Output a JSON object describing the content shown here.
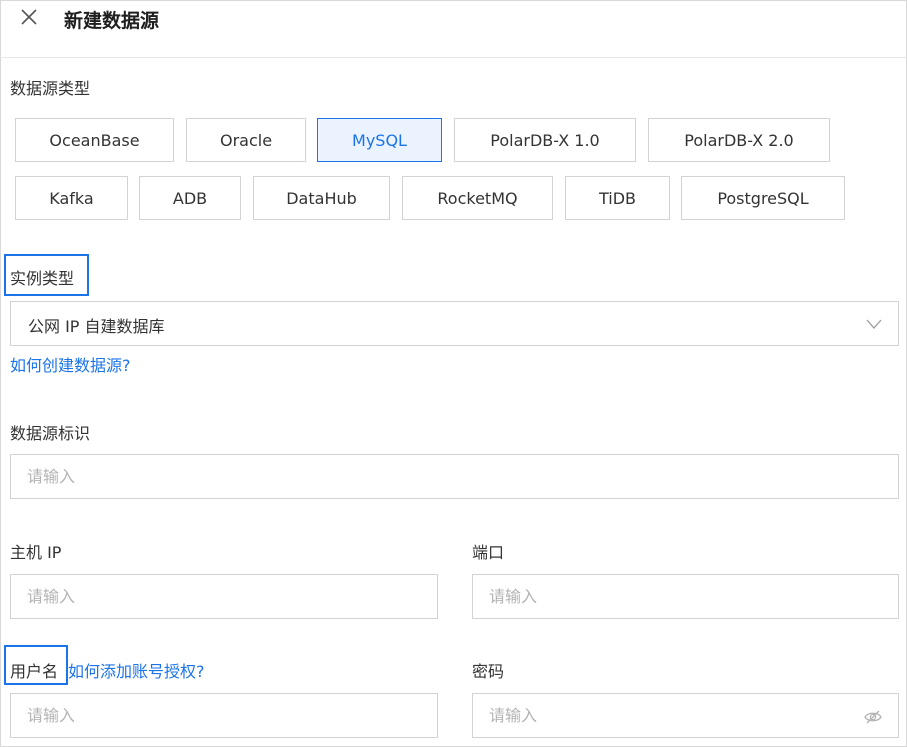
{
  "dialog": {
    "title": "新建数据源"
  },
  "datasource_type": {
    "label": "数据源类型",
    "options": [
      "OceanBase",
      "Oracle",
      "MySQL",
      "PolarDB-X 1.0",
      "PolarDB-X 2.0",
      "Kafka",
      "ADB",
      "DataHub",
      "RocketMQ",
      "TiDB",
      "PostgreSQL"
    ],
    "selected": "MySQL"
  },
  "instance_type": {
    "label": "实例类型",
    "value": "公网 IP 自建数据库",
    "help_link": "如何创建数据源?"
  },
  "identifier": {
    "label": "数据源标识",
    "placeholder": "请输入"
  },
  "host": {
    "label": "主机 IP",
    "placeholder": "请输入"
  },
  "port": {
    "label": "端口",
    "placeholder": "请输入"
  },
  "username": {
    "label": "用户名",
    "help_link": "如何添加账号授权?",
    "placeholder": "请输入"
  },
  "password": {
    "label": "密码",
    "placeholder": "请输入"
  },
  "colors": {
    "accent": "#1b74ea",
    "border": "#d3d3d3",
    "placeholder": "#b3b3b3"
  }
}
